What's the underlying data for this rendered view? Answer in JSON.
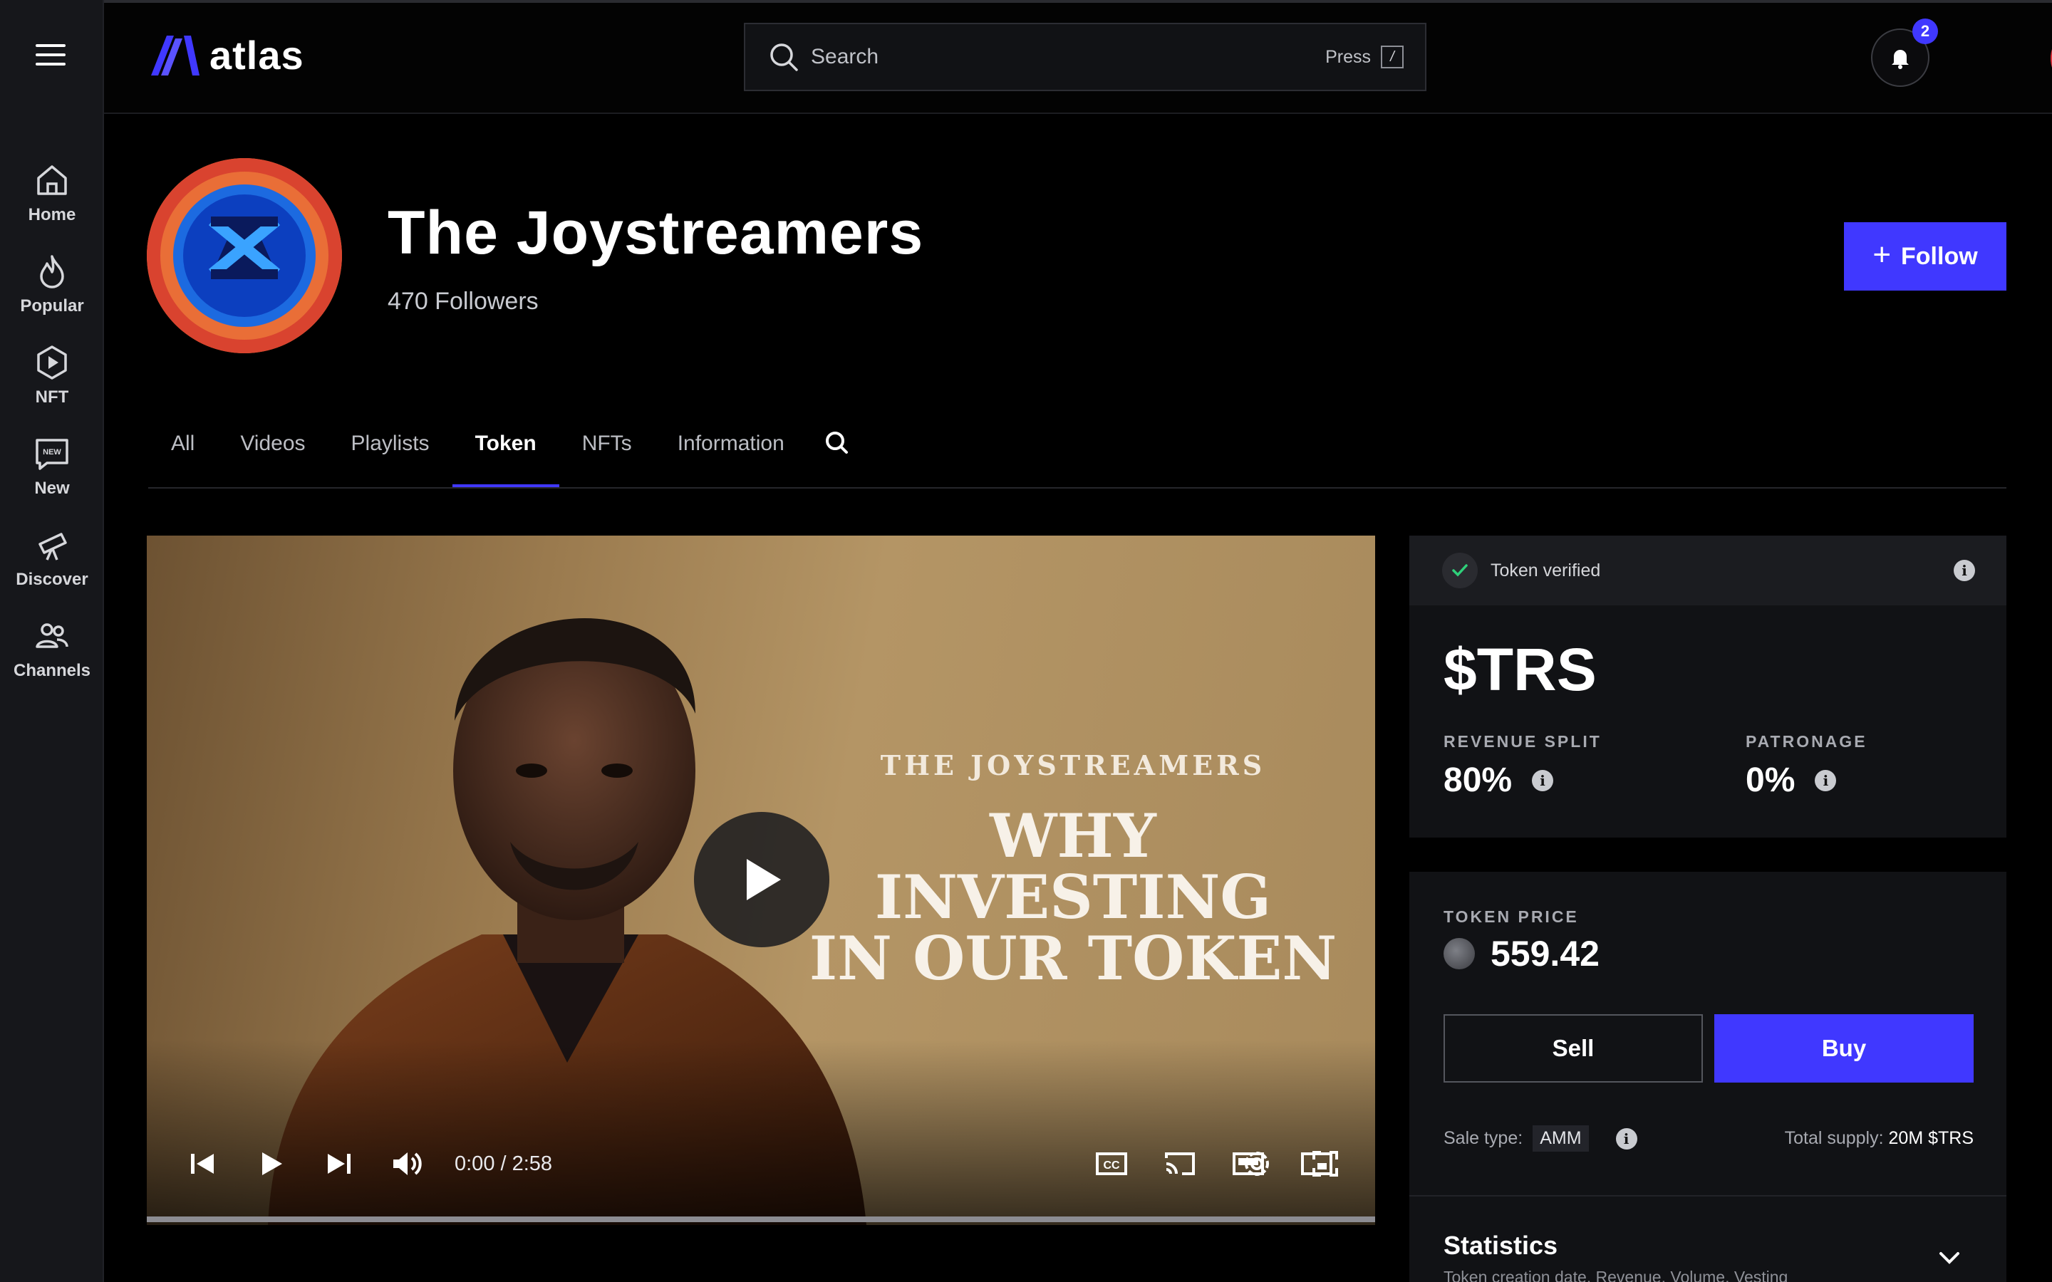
{
  "app": {
    "name": "atlas"
  },
  "sidebar": {
    "items": [
      {
        "label": "Home",
        "icon": "home-icon"
      },
      {
        "label": "Popular",
        "icon": "flame-icon"
      },
      {
        "label": "NFT",
        "icon": "play-hexagon-icon"
      },
      {
        "label": "New",
        "icon": "new-badge-icon",
        "icon_text": "NEW"
      },
      {
        "label": "Discover",
        "icon": "telescope-icon"
      },
      {
        "label": "Channels",
        "icon": "users-icon"
      }
    ]
  },
  "header": {
    "search_placeholder": "Search",
    "press_label": "Press",
    "shortcut_key": "/",
    "notifications_count": "2"
  },
  "channel": {
    "title": "The Joystreamers",
    "followers": "470 Followers",
    "follow_label": "Follow"
  },
  "tabs": [
    {
      "label": "All",
      "active": false
    },
    {
      "label": "Videos",
      "active": false
    },
    {
      "label": "Playlists",
      "active": false
    },
    {
      "label": "Token",
      "active": true
    },
    {
      "label": "NFTs",
      "active": false
    },
    {
      "label": "Information",
      "active": false
    }
  ],
  "video": {
    "overlay_subtitle": "THE JOYSTREAMERS",
    "overlay_title_lines": [
      "WHY",
      "INVESTING",
      "IN OUR TOKEN"
    ],
    "timecode": "0:00 / 2:58",
    "progress": 0
  },
  "token": {
    "verified_label": "Token verified",
    "ticker": "$TRS",
    "revenue_split_label": "REVENUE SPLIT",
    "revenue_split_value": "80%",
    "patronage_label": "PATRONAGE",
    "patronage_value": "0%",
    "price_label": "TOKEN PRICE",
    "price_value": "559.42",
    "sell_label": "Sell",
    "buy_label": "Buy",
    "sale_type_label": "Sale type:",
    "sale_type_value": "AMM",
    "total_supply_label": "Total supply:",
    "total_supply_value": "20M $TRS",
    "statistics_title": "Statistics",
    "statistics_subtitle": "Token creation date, Revenue, Volume, Vesting"
  },
  "colors": {
    "accent": "#4038ff",
    "background": "#000000",
    "panel": "#111215",
    "verified_check": "#2fd07a"
  }
}
